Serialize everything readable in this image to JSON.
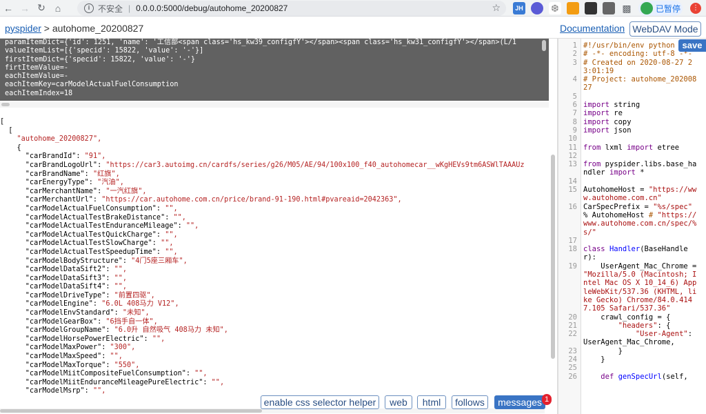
{
  "browser": {
    "insecure_label": "不安全",
    "url": "0.0.0.0:5000/debug/autohome_20200827",
    "ext_jh": "JH",
    "profile_label": "已暂停"
  },
  "header": {
    "brand_link": "pyspider",
    "brand_sep": " > ",
    "project": "autohome_20200827",
    "documentation": "Documentation",
    "webdav": "WebDAV Mode"
  },
  "console_lines": [
    "paramItemDict={'id': 1251, 'name': '工信部<span class='hs_kw39_configfY'></span><span class='hs_kw31_configfY'></span>(L/1",
    "valueItemList=[{'specid': 15822, 'value': '-'}]",
    "firstItemDict={'specid': 15822, 'value': '-'}",
    "firtItemValue=-",
    "eachItemValue=-",
    "eachItemKey=carModelActualFuelConsumption",
    "eachItemIndex=18"
  ],
  "json": {
    "open_outer": "[",
    "open_inner": "  [",
    "project_key": "\"autohome_20200827\"",
    "open_obj": "    {",
    "fields": [
      {
        "k": "carBrandId",
        "v": "\"91\""
      },
      {
        "k": "carBrandLogoUrl",
        "v": "\"https://car3.autoimg.cn/cardfs/series/g26/M05/AE/94/100x100_f40_autohomecar__wKgHEVs9tm6ASWlTAAAUz"
      },
      {
        "k": "carBrandName",
        "v": "\"红旗\""
      },
      {
        "k": "carEnergyType",
        "v": "\"汽油\""
      },
      {
        "k": "carMerchantName",
        "v": "\"一汽红旗\""
      },
      {
        "k": "carMerchantUrl",
        "v": "\"https://car.autohome.com.cn/price/brand-91-190.html#pvareaid=2042363\""
      },
      {
        "k": "carModelActualFuelConsumption",
        "v": "\"\""
      },
      {
        "k": "carModelActualTestBrakeDistance",
        "v": "\"\""
      },
      {
        "k": "carModelActualTestEnduranceMileage",
        "v": "\"\""
      },
      {
        "k": "carModelActualTestQuickCharge",
        "v": "\"\""
      },
      {
        "k": "carModelActualTestSlowCharge",
        "v": "\"\""
      },
      {
        "k": "carModelActualTestSpeedupTime",
        "v": "\"\""
      },
      {
        "k": "carModelBodyStructure",
        "v": "\"4门5座三厢车\""
      },
      {
        "k": "carModelDataSift2",
        "v": "\"\""
      },
      {
        "k": "carModelDataSift3",
        "v": "\"\""
      },
      {
        "k": "carModelDataSift4",
        "v": "\"\""
      },
      {
        "k": "carModelDriveType",
        "v": "\"前置四驱\""
      },
      {
        "k": "carModelEngine",
        "v": "\"6.0L 408马力 V12\""
      },
      {
        "k": "carModelEnvStandard",
        "v": "\"未知\""
      },
      {
        "k": "carModelGearBox",
        "v": "\"6挡手自一体\""
      },
      {
        "k": "carModelGroupName",
        "v": "\"6.0升 自然吸气 408马力 未知\""
      },
      {
        "k": "carModelHorsePowerElectric",
        "v": "\"\""
      },
      {
        "k": "carModelMaxPower",
        "v": "\"300\""
      },
      {
        "k": "carModelMaxSpeed",
        "v": "\"\""
      },
      {
        "k": "carModelMaxTorque",
        "v": "\"550\""
      },
      {
        "k": "carModelMiitCompositeFuelConsumption",
        "v": "\"\""
      },
      {
        "k": "carModelMiitEnduranceMileagePureElectric",
        "v": "\"\""
      },
      {
        "k": "carModelMsrp",
        "v": "\"\""
      }
    ]
  },
  "buttons": {
    "css_helper": "enable css selector helper",
    "web": "web",
    "html": "html",
    "follows": "follows",
    "messages": "messages",
    "messages_count": "1"
  },
  "editor": {
    "save": "save",
    "lines": [
      {
        "n": "1",
        "t": "#!/usr/bin/env python",
        "c": "cm"
      },
      {
        "n": "2",
        "t": "# -*- encoding: utf-8 -*-",
        "c": "cm"
      },
      {
        "n": "3",
        "t": "# Created on 2020-08-27 23:01:19",
        "c": "cm"
      },
      {
        "n": "4",
        "t": "# Project: autohome_20200827",
        "c": "cm"
      },
      {
        "n": "5",
        "t": "",
        "c": ""
      },
      {
        "n": "6",
        "t": "import string",
        "c": "imp"
      },
      {
        "n": "7",
        "t": "import re",
        "c": "imp"
      },
      {
        "n": "8",
        "t": "import copy",
        "c": "imp"
      },
      {
        "n": "9",
        "t": "import json",
        "c": "imp"
      },
      {
        "n": "10",
        "t": "",
        "c": ""
      },
      {
        "n": "11",
        "t": "from lxml import etree",
        "c": "from"
      },
      {
        "n": "12",
        "t": "",
        "c": ""
      },
      {
        "n": "13",
        "t": "from pyspider.libs.base_handler import *",
        "c": "from"
      },
      {
        "n": "14",
        "t": "",
        "c": ""
      },
      {
        "n": "15",
        "t": "AutohomeHost = \"https://www.autohome.com.cn\"",
        "c": "asg"
      },
      {
        "n": "16",
        "t": "CarSpecPrefix = \"%s/spec\" % AutohomeHost # \"https://www.autohome.com.cn/spec/%s/\"",
        "c": "asg"
      },
      {
        "n": "17",
        "t": "",
        "c": ""
      },
      {
        "n": "18",
        "t": "class Handler(BaseHandler):",
        "c": "cls"
      },
      {
        "n": "19",
        "t": "    UserAgent_Mac_Chrome = \"Mozilla/5.0 (Macintosh; Intel Mac OS X 10_14_6) AppleWebKit/537.36 (KHTML, like Gecko) Chrome/84.0.4147.105 Safari/537.36\"",
        "c": "asg"
      },
      {
        "n": "20",
        "t": "    crawl_config = {",
        "c": ""
      },
      {
        "n": "21",
        "t": "        \"headers\": {",
        "c": "asg"
      },
      {
        "n": "22",
        "t": "            \"User-Agent\": UserAgent_Mac_Chrome,",
        "c": "asg"
      },
      {
        "n": "23",
        "t": "        }",
        "c": ""
      },
      {
        "n": "24",
        "t": "    }",
        "c": ""
      },
      {
        "n": "25",
        "t": "",
        "c": ""
      },
      {
        "n": "26",
        "t": "    def genSpecUrl(self,",
        "c": "def"
      }
    ]
  }
}
